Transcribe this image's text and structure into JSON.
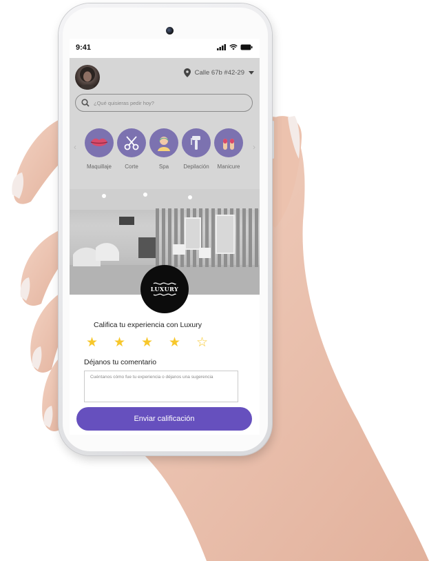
{
  "status_bar": {
    "time": "9:41"
  },
  "header": {
    "address": "Calle 67b #42-29"
  },
  "search": {
    "placeholder": "¿Qué quisieras pedir hoy?"
  },
  "categories": [
    {
      "label": "Maquillaje",
      "icon": "lips-icon"
    },
    {
      "label": "Corte",
      "icon": "scissors-icon"
    },
    {
      "label": "Spa",
      "icon": "spa-icon"
    },
    {
      "label": "Depilación",
      "icon": "razor-icon"
    },
    {
      "label": "Manicure",
      "icon": "nail-polish-icon"
    }
  ],
  "business": {
    "logo_text": "LUXURY"
  },
  "rating": {
    "title": "Califica tu experiencia con Luxury",
    "stars_filled": 4,
    "stars_total": 5,
    "comment_title": "Déjanos tu comentario",
    "comment_placeholder": "Cuéntanos cómo fue tu experiencia o déjanos una sugerencia",
    "submit_label": "Enviar calificación"
  },
  "colors": {
    "accent": "#6650be",
    "star": "#f7c72b",
    "category_circle": "#7c72b0"
  }
}
